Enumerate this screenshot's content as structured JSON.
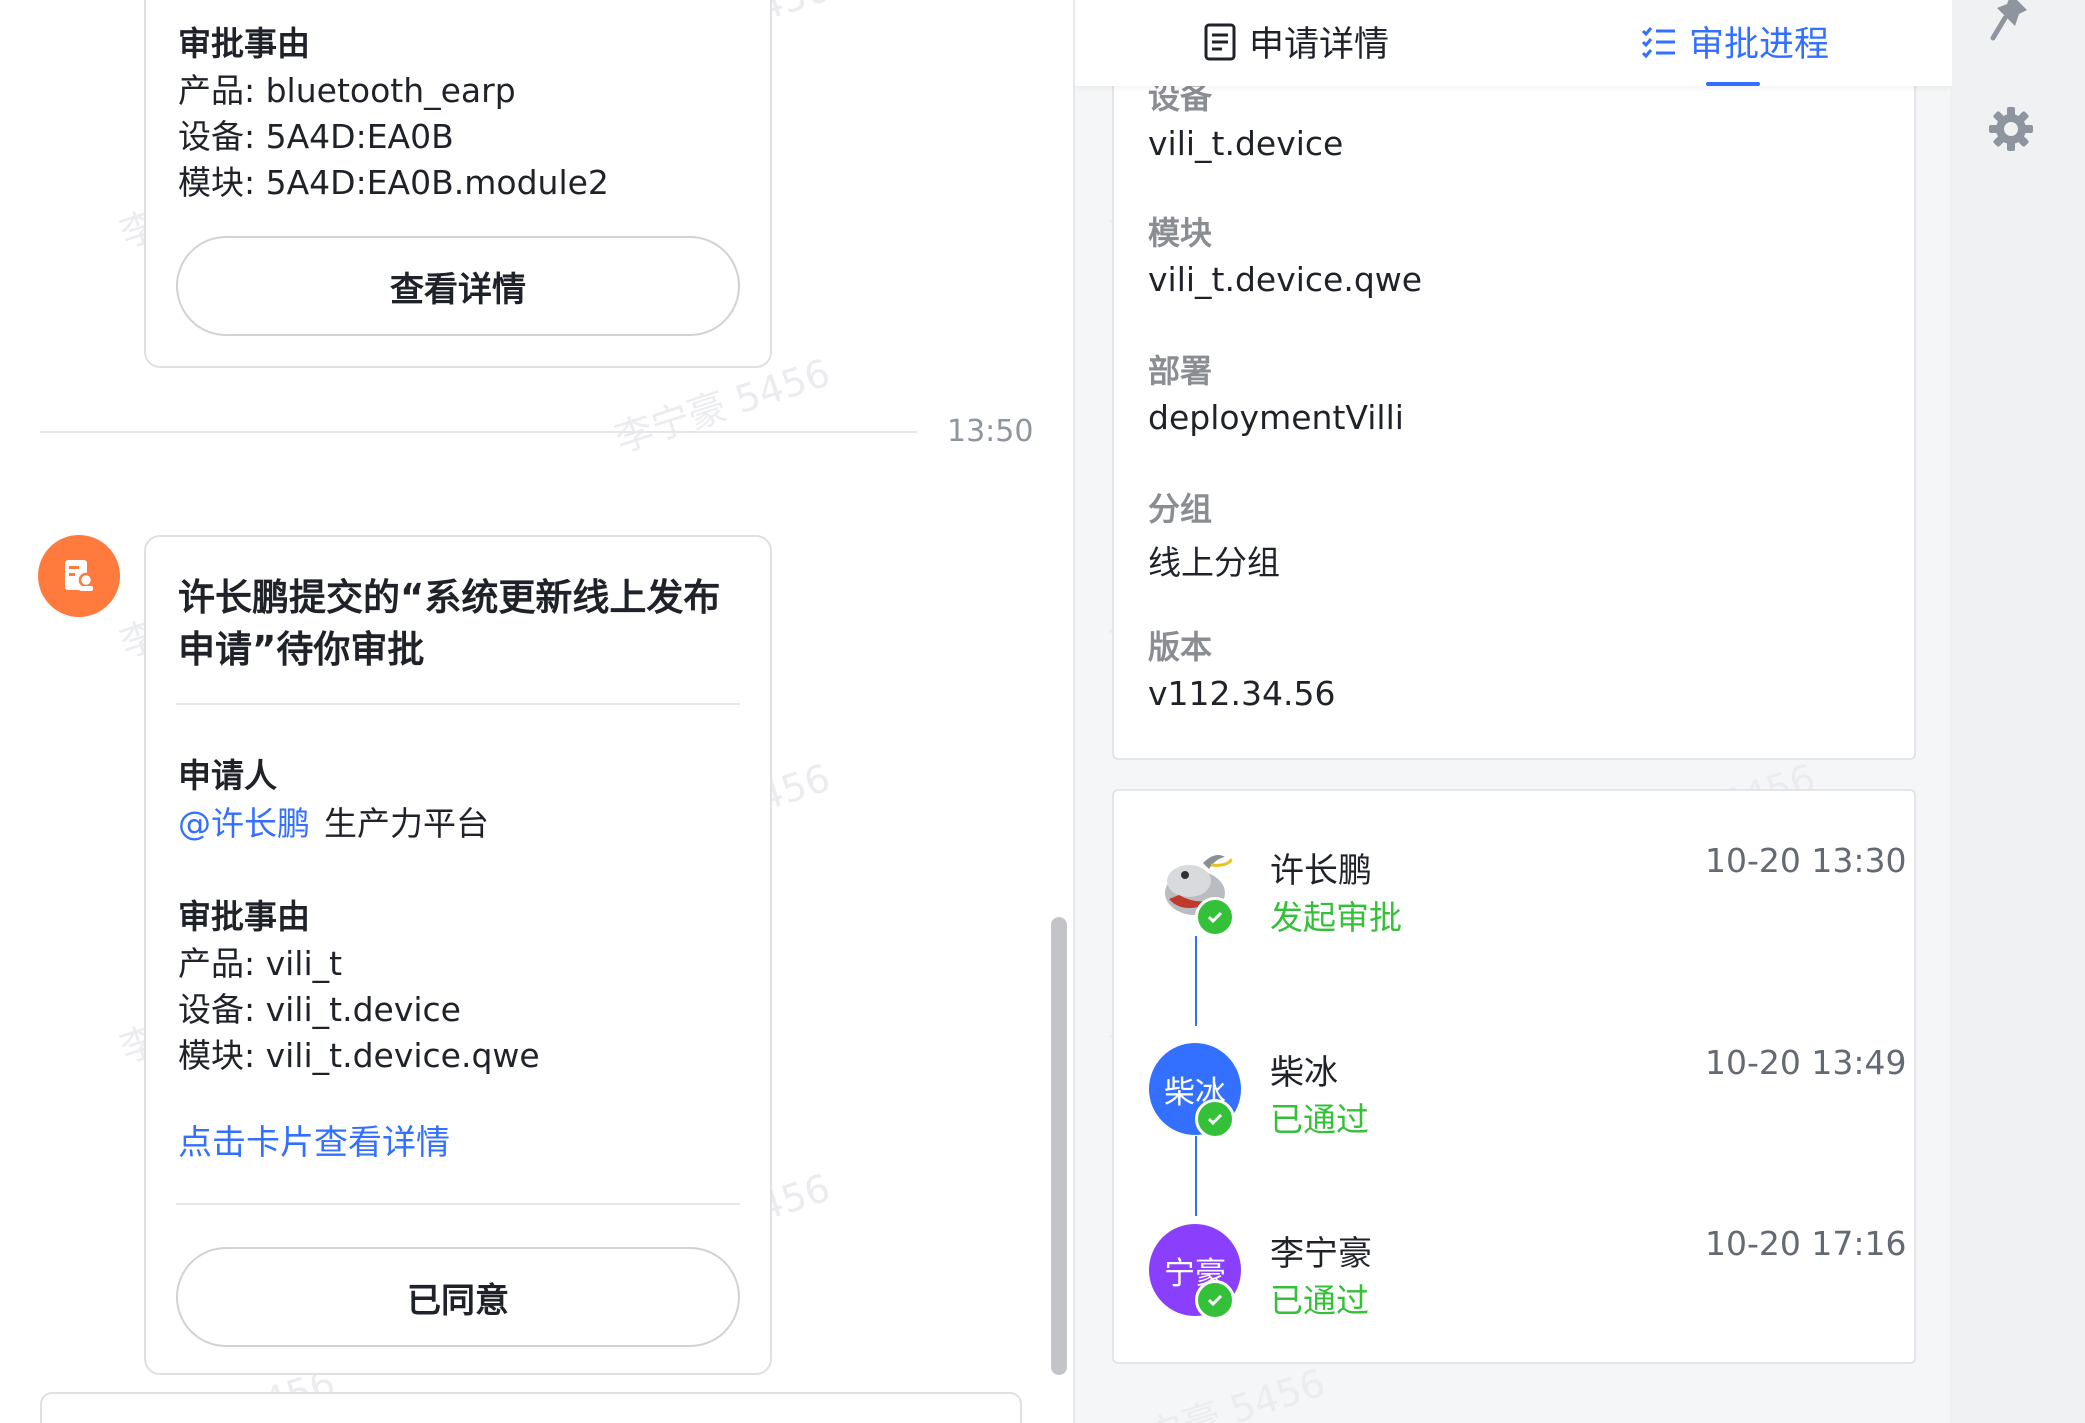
{
  "chat": {
    "top_card": {
      "reason_label": "审批事由",
      "product": "产品: bluetooth_earp",
      "device": "设备: 5A4D:EA0B",
      "module": "模块: 5A4D:EA0B.module2",
      "view_button": "查看详情"
    },
    "time_divider": "13:50",
    "approval_card": {
      "title": "许长鹏提交的“系统更新线上发布申请”待你审批",
      "applicant_label": "申请人",
      "applicant_mention": "@许长鹏",
      "applicant_team": "生产力平台",
      "reason_label": "审批事由",
      "product": "产品: vili_t",
      "device": "设备: vili_t.device",
      "module": "模块: vili_t.device.qwe",
      "detail_link": "点击卡片查看详情",
      "agreed_button": "已同意"
    },
    "watermark": "李宁豪 5456",
    "accent": "#3370ff",
    "avatar_color": "#ff7a3d"
  },
  "panel": {
    "tabs": [
      {
        "label": "申请详情",
        "icon": "document-icon",
        "active": false
      },
      {
        "label": "审批进程",
        "icon": "list-icon",
        "active": true
      }
    ],
    "details": {
      "partial_label": "设备",
      "device_value": "vili_t.device",
      "fields": [
        {
          "label": "模块",
          "value": "vili_t.device.qwe"
        },
        {
          "label": "部署",
          "value": "deploymentVilli"
        },
        {
          "label": "分组",
          "value": "线上分组"
        },
        {
          "label": "版本",
          "value": "v112.34.56"
        }
      ]
    },
    "timeline": [
      {
        "name": "许长鹏",
        "status": "发起审批",
        "time": "10-20 13:30",
        "avatar_text": "",
        "avatar_color": "#ffffff"
      },
      {
        "name": "柴冰",
        "status": "已通过",
        "time": "10-20 13:49",
        "avatar_text": "柴冰",
        "avatar_color": "#3370ff"
      },
      {
        "name": "李宁豪",
        "status": "已通过",
        "time": "10-20 17:16",
        "avatar_text": "宁豪",
        "avatar_color": "#8a3ffc"
      }
    ],
    "status_color": "#35c03a"
  },
  "rail": {
    "icons": [
      "pin-icon",
      "gear-icon"
    ]
  }
}
